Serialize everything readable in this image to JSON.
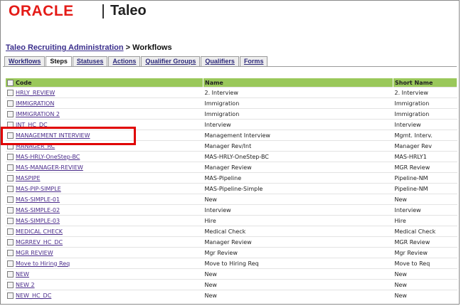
{
  "header": {
    "brand_oracle": "ORACLE",
    "brand_taleo": "Taleo"
  },
  "breadcrumb": {
    "link": "Taleo Recruiting Administration",
    "separator": " > ",
    "current": "Workflows"
  },
  "tabs": [
    {
      "label": "Workflows",
      "active": false
    },
    {
      "label": "Steps",
      "active": true
    },
    {
      "label": "Statuses",
      "active": false
    },
    {
      "label": "Actions",
      "active": false
    },
    {
      "label": "Qualifier Groups",
      "active": false
    },
    {
      "label": "Qualifiers",
      "active": false
    },
    {
      "label": "Forms",
      "active": false
    }
  ],
  "table": {
    "headers": {
      "code": "Code",
      "name": "Name",
      "short_name": "Short Name"
    },
    "rows": [
      {
        "code": "HRLY_REVIEW",
        "name": "2. Interview",
        "short": "2. Interview"
      },
      {
        "code": "IMMIGRATION",
        "name": "Immigration",
        "short": "Immigration"
      },
      {
        "code": "IMMIGRATION 2",
        "name": "Immigration",
        "short": "Immigration"
      },
      {
        "code": "INT_HC_DC",
        "name": "Interview",
        "short": "Interview"
      },
      {
        "code": "MANAGEMENT INTERVIEW",
        "name": "Management Interview",
        "short": "Mgmt. Interv."
      },
      {
        "code": "MANAGER_RC",
        "name": "Manager Rev/Int",
        "short": "Manager Rev"
      },
      {
        "code": "MAS-HRLY-OneStep-BC",
        "name": "MAS-HRLY-OneStep-BC",
        "short": "MAS-HRLY1"
      },
      {
        "code": "MAS-MANAGER-REVIEW",
        "name": "Manager Review",
        "short": "MGR Review"
      },
      {
        "code": "MASPIPE",
        "name": "MAS-Pipeline",
        "short": "Pipeline-NM"
      },
      {
        "code": "MAS-PIP-SIMPLE",
        "name": "MAS-Pipeline-Simple",
        "short": "Pipeline-NM"
      },
      {
        "code": "MAS-SIMPLE-01",
        "name": "New",
        "short": "New"
      },
      {
        "code": "MAS-SIMPLE-02",
        "name": "Interview",
        "short": "Interview"
      },
      {
        "code": "MAS-SIMPLE-03",
        "name": "Hire",
        "short": "Hire"
      },
      {
        "code": "MEDICAL CHECK",
        "name": "Medical Check",
        "short": "Medical Check"
      },
      {
        "code": "MGRREV_HC_DC",
        "name": "Manager Review",
        "short": "MGR Review"
      },
      {
        "code": "MGR REVIEW",
        "name": "Mgr Review",
        "short": "Mgr Review"
      },
      {
        "code": "Move to Hiring Req",
        "name": "Move to Hiring Req",
        "short": "Move to Req"
      },
      {
        "code": "NEW",
        "name": "New",
        "short": "New"
      },
      {
        "code": "NEW 2",
        "name": "New",
        "short": "New"
      },
      {
        "code": "NEW_HC_DC",
        "name": "New",
        "short": "New"
      }
    ]
  },
  "colors": {
    "header_row": "#9ac85a",
    "highlight": "#e00000",
    "brand_red": "#e41b17",
    "link": "#4a2b8a"
  }
}
